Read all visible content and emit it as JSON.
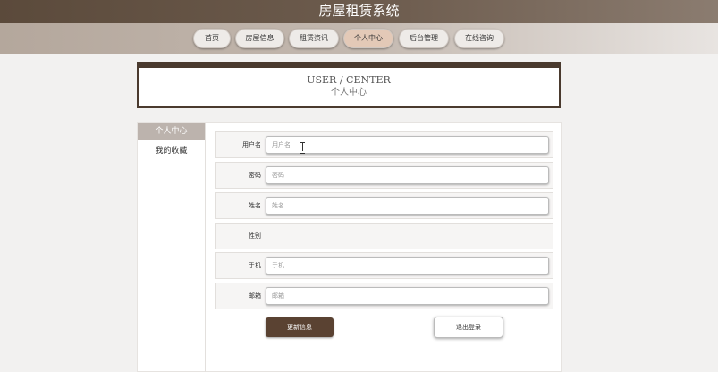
{
  "app": {
    "title": "房屋租赁系统"
  },
  "nav": {
    "items": [
      {
        "label": "首页"
      },
      {
        "label": "房屋信息"
      },
      {
        "label": "租赁资讯"
      },
      {
        "label": "个人中心",
        "active": true
      },
      {
        "label": "后台管理"
      },
      {
        "label": "在线咨询"
      }
    ]
  },
  "user_center": {
    "title_en": "USER / CENTER",
    "title_cn": "个人中心"
  },
  "sidebar": {
    "items": [
      {
        "label": "个人中心",
        "active": true
      },
      {
        "label": "我的收藏"
      }
    ]
  },
  "form": {
    "fields": [
      {
        "label": "用户名",
        "placeholder": "用户名",
        "value": ""
      },
      {
        "label": "密码",
        "placeholder": "密码",
        "value": ""
      },
      {
        "label": "姓名",
        "placeholder": "姓名",
        "value": ""
      },
      {
        "label": "性别"
      },
      {
        "label": "手机",
        "placeholder": "手机",
        "value": ""
      },
      {
        "label": "邮箱",
        "placeholder": "邮箱",
        "value": ""
      }
    ],
    "update_label": "更新信息",
    "logout_label": "退出登录"
  },
  "colors": {
    "brand_dark": "#5a4232",
    "nav_active": "#e3c9b7",
    "sidebar_active": "#bcb3ad"
  }
}
